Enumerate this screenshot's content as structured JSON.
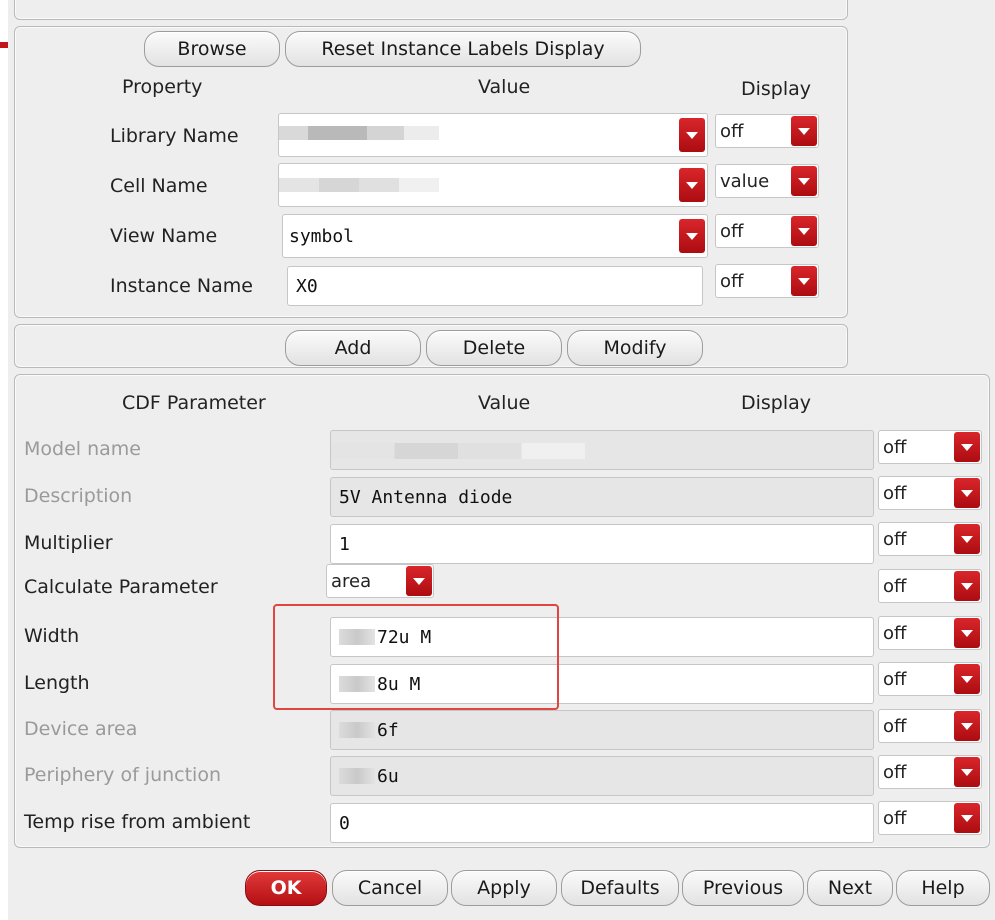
{
  "top_buttons": {
    "browse": "Browse",
    "reset_labels": "Reset Instance Labels Display"
  },
  "instance_table": {
    "headers": {
      "property": "Property",
      "value": "Value",
      "display": "Display"
    },
    "rows": [
      {
        "label": "Library Name",
        "value": "",
        "display": "off"
      },
      {
        "label": "Cell Name",
        "value": "",
        "display": "value"
      },
      {
        "label": "View Name",
        "value": "symbol",
        "display": "off"
      },
      {
        "label": "Instance Name",
        "value": "X0",
        "display": "off"
      }
    ]
  },
  "edit_buttons": {
    "add": "Add",
    "delete": "Delete",
    "modify": "Modify"
  },
  "cdf_table": {
    "headers": {
      "parameter": "CDF Parameter",
      "value": "Value",
      "display": "Display"
    },
    "rows": [
      {
        "label": "Model name",
        "value": "",
        "display": "off",
        "enabled": false
      },
      {
        "label": "Description",
        "value": "5V Antenna diode",
        "display": "off",
        "enabled": false
      },
      {
        "label": "Multiplier",
        "value": "1",
        "display": "off",
        "enabled": true
      },
      {
        "label": "Calculate Parameter",
        "value": "area",
        "display": "off",
        "enabled": true
      },
      {
        "label": "Width",
        "value": "72u M",
        "display": "off",
        "enabled": true
      },
      {
        "label": "Length",
        "value": "8u M",
        "display": "off",
        "enabled": true
      },
      {
        "label": "Device area",
        "value": "6f",
        "display": "off",
        "enabled": false
      },
      {
        "label": "Periphery of junction",
        "value": "6u",
        "display": "off",
        "enabled": false
      },
      {
        "label": "Temp rise from ambient",
        "value": "0",
        "display": "off",
        "enabled": true
      }
    ]
  },
  "bottom_buttons": {
    "ok": "OK",
    "cancel": "Cancel",
    "apply": "Apply",
    "defaults": "Defaults",
    "previous": "Previous",
    "next": "Next",
    "help": "Help"
  },
  "colors": {
    "accent": "#c4141a",
    "highlight": "#e0463f",
    "panel": "#eeeeee",
    "disabled_text": "#9a9a9a"
  }
}
